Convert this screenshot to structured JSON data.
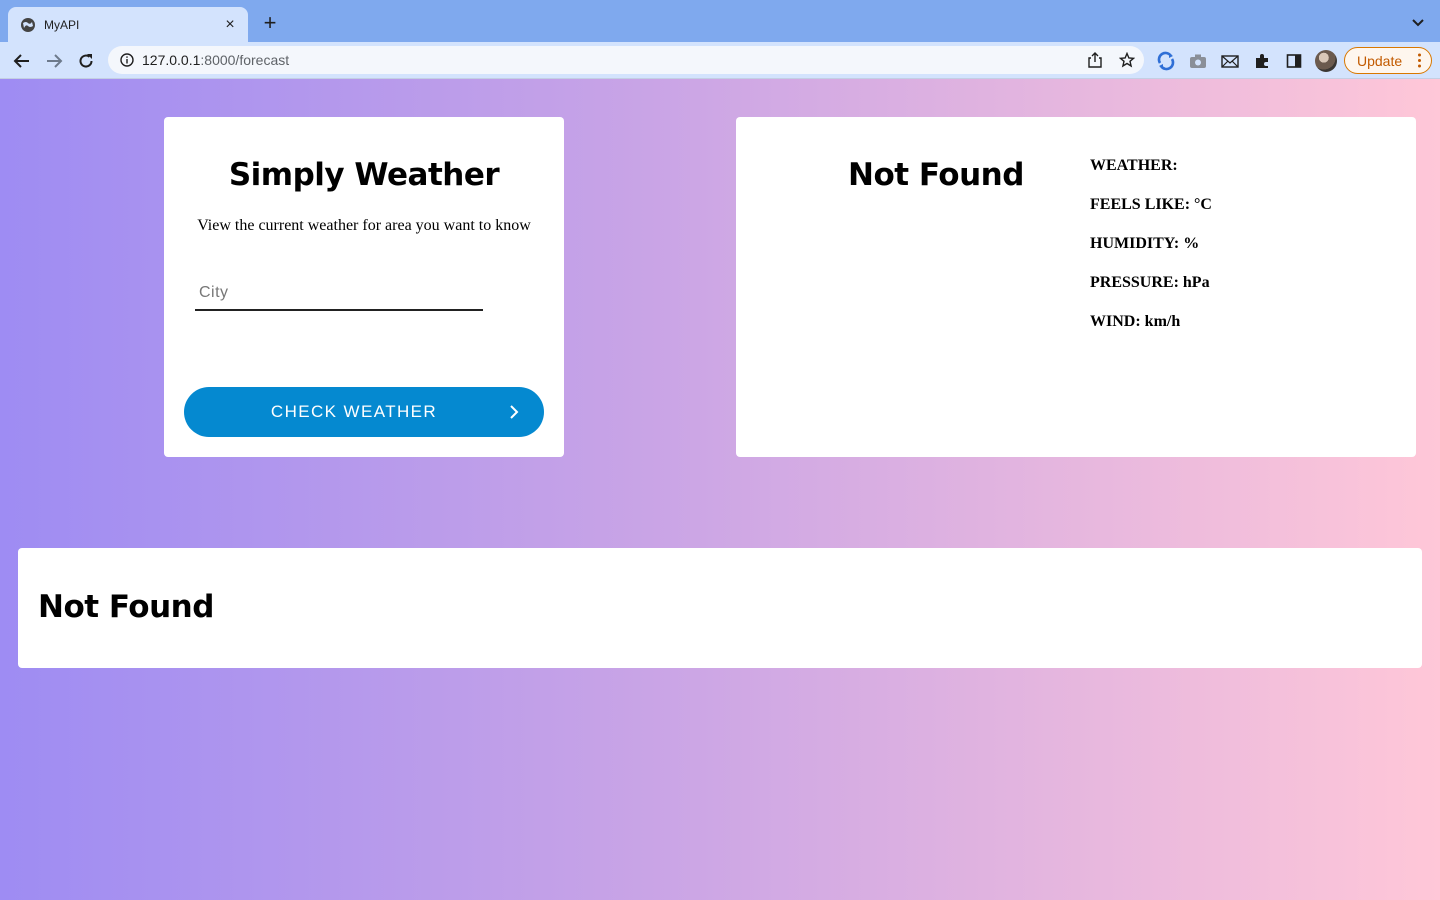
{
  "browser": {
    "tab_title": "MyAPI",
    "tab_close": "×",
    "new_tab": "+",
    "url_host": "127.0.0.1",
    "url_path": ":8000/forecast",
    "update_label": "Update"
  },
  "search_card": {
    "title": "Simply Weather",
    "subtitle": "View the current weather for area you want to know",
    "city_placeholder": "City",
    "city_value": "",
    "button_label": "CHECK WEATHER"
  },
  "current_card": {
    "title": "Not Found",
    "weather": "WEATHER: ",
    "feels_like": "FEELS LIKE: °C",
    "humidity": "HUMIDITY: %",
    "pressure": "PRESSURE: hPa",
    "wind": "WIND: km/h"
  },
  "forecast_card": {
    "title": "Not Found"
  },
  "colors": {
    "button": "#0589d0",
    "gradient_start": "#9e8cf3",
    "gradient_end": "#ffc7d8",
    "update_accent": "#d97800"
  }
}
